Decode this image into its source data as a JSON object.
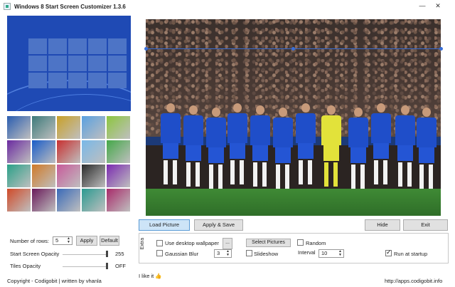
{
  "window": {
    "title": "Windows 8 Start Screen Customizer 1.3.6",
    "minimize_icon": "—",
    "close_icon": "✕"
  },
  "swatches": [
    "#2a5db0",
    "#3d7a7a",
    "#c9a028",
    "#5aa0e0",
    "#8cc63f",
    "#6a2aa0",
    "#1a5cc8",
    "#c83030",
    "#78b8e8",
    "#44a848",
    "#2aa088",
    "#d07a28",
    "#c85a9a",
    "#2a2a2a",
    "#7a2ab0",
    "#d04a28",
    "#6a1a5a",
    "#3a6ab8",
    "#2a9a90",
    "#a82a6a"
  ],
  "options": {
    "rows_label": "Number of rows:",
    "rows_value": "5",
    "apply_label": "Apply",
    "default_label": "Default",
    "start_opacity_label": "Start Screen Opacity",
    "start_opacity_value": "255",
    "tiles_opacity_label": "Tiles Opacity",
    "tiles_opacity_value": "OFF"
  },
  "buttons": {
    "load_picture": "Load Picture",
    "apply_save": "Apply & Save",
    "hide": "Hide",
    "exit": "Exit"
  },
  "extra": {
    "label": "Extra",
    "use_desktop_wallpaper": "Use desktop wallpaper",
    "browse": "...",
    "select_pictures": "Select Pictures",
    "random": "Random",
    "gaussian_blur": "Gaussian Blur",
    "blur_value": "3",
    "slideshow": "Slideshow",
    "interval_label": "Interval",
    "interval_value": "10",
    "run_at_startup": "Run at startup",
    "run_at_startup_checked": true
  },
  "footer": {
    "like": "I like it",
    "like_icon": "thumbs-up-icon",
    "copyright": "Copyright - Codigobit | written by vhanla",
    "url": "http://apps.codigobit.info"
  },
  "colors": {
    "preview_bg": "#1f4ab4",
    "accent": "#3a6fd8"
  }
}
